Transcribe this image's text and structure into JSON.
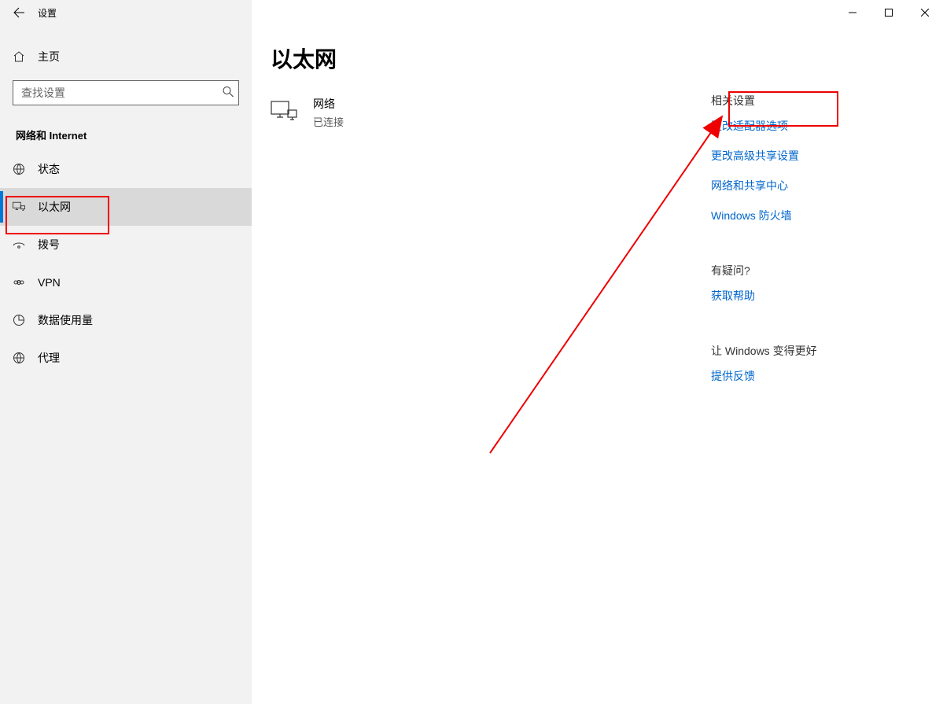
{
  "titlebar": {
    "app_name": "设置"
  },
  "sidebar": {
    "home_label": "主页",
    "search_placeholder": "查找设置",
    "section_label": "网络和 Internet",
    "items": [
      {
        "label": "状态"
      },
      {
        "label": "以太网"
      },
      {
        "label": "拨号"
      },
      {
        "label": "VPN"
      },
      {
        "label": "数据使用量"
      },
      {
        "label": "代理"
      }
    ]
  },
  "main": {
    "page_title": "以太网",
    "network": {
      "name": "网络",
      "status": "已连接"
    }
  },
  "aside": {
    "related_title": "相关设置",
    "links": [
      "更改适配器选项",
      "更改高级共享设置",
      "网络和共享中心",
      "Windows 防火墙"
    ],
    "question_title": "有疑问?",
    "help_link": "获取帮助",
    "improve_title": "让 Windows 变得更好",
    "feedback_link": "提供反馈"
  }
}
